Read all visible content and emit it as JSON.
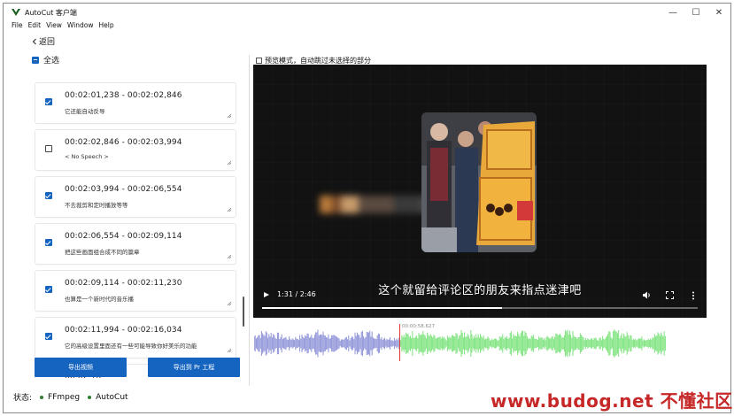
{
  "window": {
    "title": "AutoCut 客户端",
    "controls": {
      "minimize": "—",
      "maximize": "☐",
      "close": "✕"
    }
  },
  "menu": [
    "File",
    "Edit",
    "View",
    "Window",
    "Help"
  ],
  "nav": {
    "back_label": "返回",
    "back_icon": "chevron-left-icon"
  },
  "list": {
    "select_all_label": "全选",
    "items": [
      {
        "time": "00:02:01,238 - 00:02:02,846",
        "text": "它还能自动反导",
        "checked": true
      },
      {
        "time": "00:02:02,846 - 00:02:03,994",
        "text": "< No Speech >",
        "checked": false
      },
      {
        "time": "00:02:03,994 - 00:02:06,554",
        "text": "不去裁剪和定时播放等等",
        "checked": true
      },
      {
        "time": "00:02:06,554 - 00:02:09,114",
        "text": "把这些画面组合成不同的篇章",
        "checked": true
      },
      {
        "time": "00:02:09,114 - 00:02:11,230",
        "text": "也算是一个新时代的音乐播",
        "checked": true
      },
      {
        "time": "00:02:11,994 - 00:02:16,034",
        "text": "它的高级设置里面还有一些可能导致你好美乐的功能",
        "checked": true
      },
      {
        "time": "00:02:16",
        "text": "",
        "checked": true
      }
    ]
  },
  "actions": {
    "export_video": "导出视频",
    "export_pr": "导出到 Pr 工程"
  },
  "status": {
    "label": "状态:",
    "items": [
      "FFmpeg",
      "AutoCut"
    ]
  },
  "preview": {
    "mode_label": "预览模式，自动跳过未选择的部分",
    "subtitle": "这个就留给评论区的朋友来指点迷津吧",
    "timecode": "1:31 / 2:46",
    "progress": 0.55,
    "icons": {
      "play": "play-icon",
      "volume": "volume-icon",
      "fullscreen": "fullscreen-icon",
      "more": "more-vertical-icon"
    }
  },
  "waveform": {
    "playhead_time": "00:00:58.627",
    "played_color": "#8f93d8",
    "remaining_color": "#7de37d"
  },
  "watermark": "www.budog.net 不懂社区",
  "colors": {
    "accent": "#1565c0",
    "status_dot": "#2e7d32",
    "playhead": "#e53935",
    "watermark": "#c62828"
  }
}
